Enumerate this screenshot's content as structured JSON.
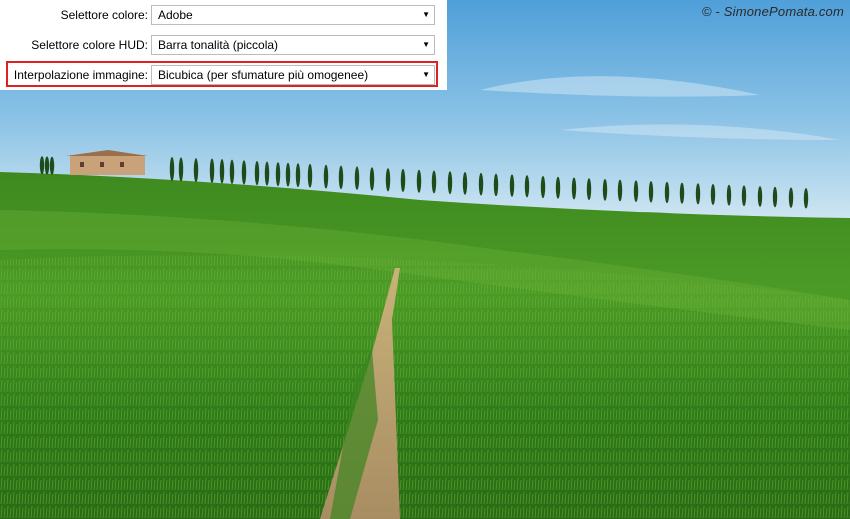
{
  "settings": {
    "color_picker": {
      "label": "Selettore colore:",
      "value": "Adobe"
    },
    "hud_color_picker": {
      "label": "Selettore colore HUD:",
      "value": "Barra tonalità (piccola)"
    },
    "image_interpolation": {
      "label": "Interpolazione immagine:",
      "value": "Bicubica (per sfumature più omogenee)"
    }
  },
  "photo": {
    "credit": "© - SimonePomata.com"
  },
  "colors": {
    "highlight": "#e02020",
    "sky_top": "#5aa6dc",
    "field": "#3f8a22"
  },
  "icons": {
    "dropdown": "chevron-down-icon"
  }
}
